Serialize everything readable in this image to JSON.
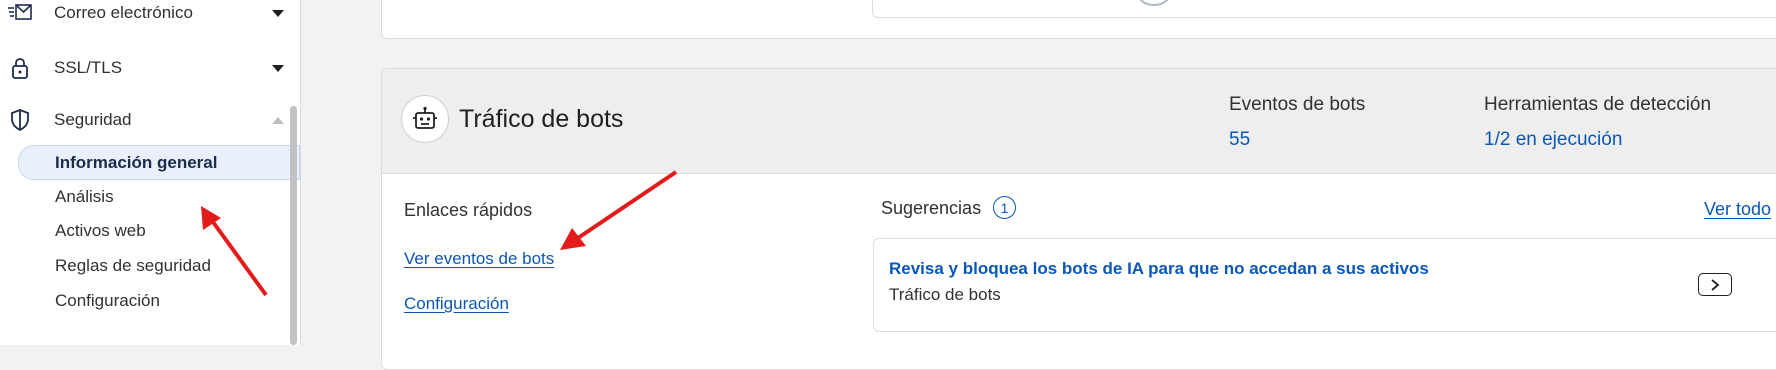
{
  "sidebar": {
    "items": [
      {
        "label": "Correo electrónico",
        "icon": "mail-icon",
        "expanded": false
      },
      {
        "label": "SSL/TLS",
        "icon": "lock-icon",
        "expanded": false
      },
      {
        "label": "Seguridad",
        "icon": "shield-icon",
        "expanded": true
      }
    ],
    "subitems": [
      {
        "label": "Información general",
        "active": true
      },
      {
        "label": "Análisis",
        "active": false
      },
      {
        "label": "Activos web",
        "active": false
      },
      {
        "label": "Reglas de seguridad",
        "active": false
      },
      {
        "label": "Configuración",
        "active": false
      }
    ]
  },
  "bot_traffic": {
    "icon": "robot-icon",
    "title": "Tráfico de bots",
    "stats": [
      {
        "label": "Eventos de bots",
        "value": "55"
      },
      {
        "label": "Herramientas de detección",
        "value": "1/2 en ejecución"
      }
    ],
    "quick_links": {
      "label": "Enlaces rápidos",
      "links": [
        "Ver eventos de bots",
        "Configuración"
      ]
    },
    "suggestions": {
      "label": "Sugerencias",
      "count": "1",
      "view_all": "Ver todo",
      "items": [
        {
          "title": "Revisa y bloquea los bots de IA para que no accedan a sus activos",
          "subtitle": "Tráfico de bots",
          "icon": "chevron-right-icon"
        }
      ]
    }
  },
  "colors": {
    "accent": "#0b57b5",
    "annotation_arrow": "#e31b1b",
    "active_bg": "#e8f0fb"
  }
}
